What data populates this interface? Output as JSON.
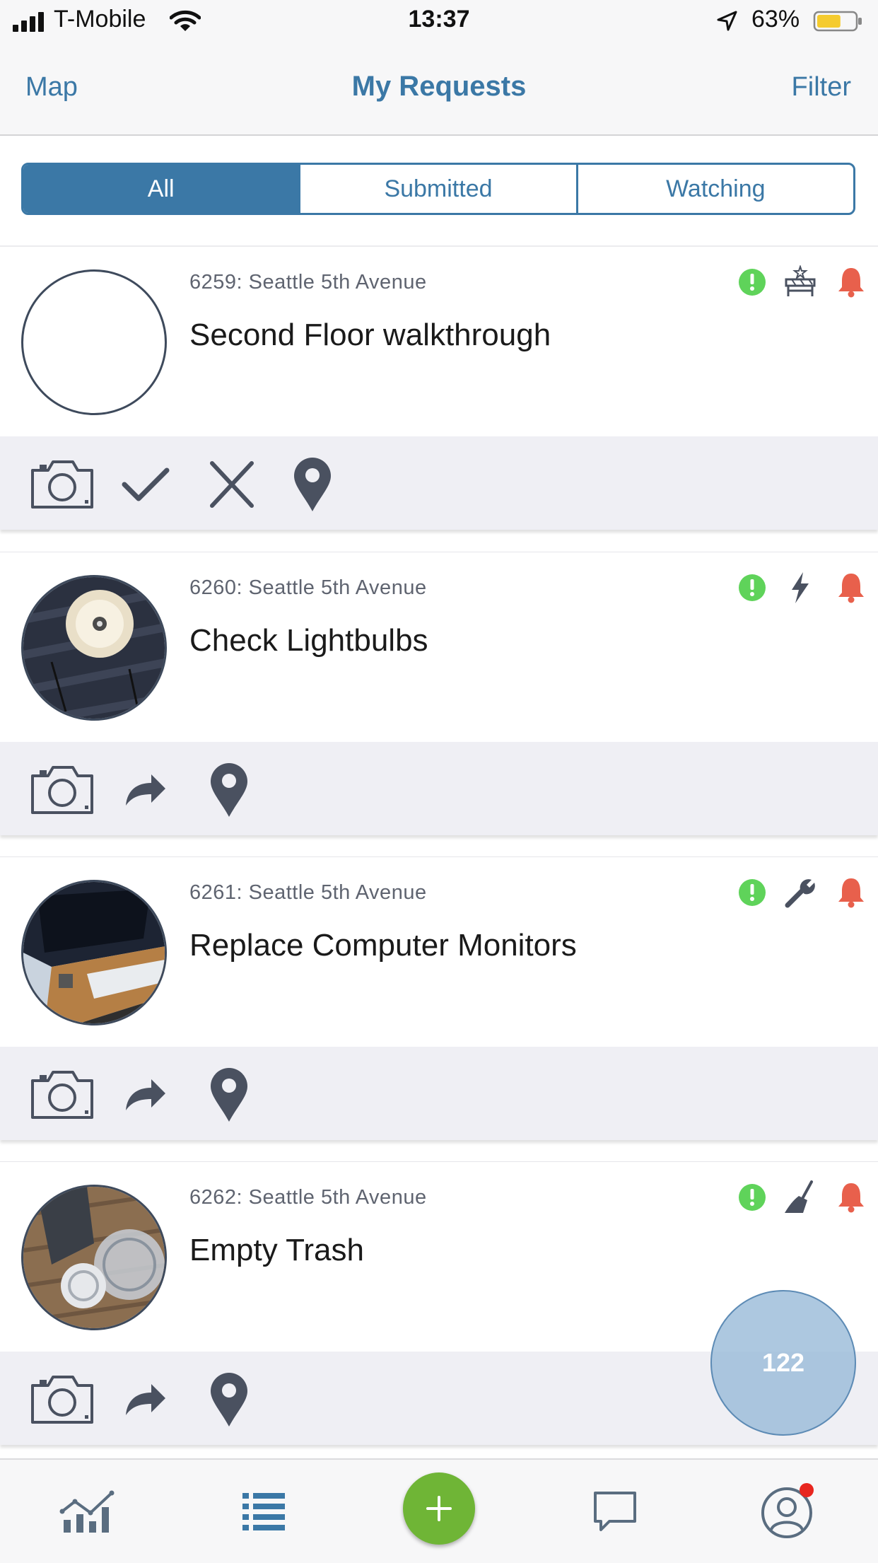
{
  "status_bar": {
    "carrier": "T-Mobile",
    "time": "13:37",
    "battery_percent": "63%",
    "battery_level": 0.63
  },
  "nav": {
    "left": "Map",
    "title": "My Requests",
    "right": "Filter"
  },
  "segments": [
    {
      "label": "All",
      "active": true
    },
    {
      "label": "Submitted",
      "active": false
    },
    {
      "label": "Watching",
      "active": false
    }
  ],
  "requests": [
    {
      "subtitle": "6259: Seattle 5th Avenue",
      "title": "Second Floor walkthrough",
      "photo": "none",
      "category_icon": "furniture-icon",
      "actions": [
        "camera-icon",
        "checkmark-icon",
        "close-icon",
        "location-pin-icon"
      ]
    },
    {
      "subtitle": "6260: Seattle 5th Avenue",
      "title": "Check Lightbulbs",
      "photo": "lightbulb-photo",
      "category_icon": "lightning-icon",
      "actions": [
        "camera-icon",
        "forward-icon",
        "location-pin-icon"
      ]
    },
    {
      "subtitle": "6261: Seattle 5th Avenue",
      "title": "Replace Computer Monitors",
      "photo": "monitor-photo",
      "category_icon": "wrench-icon",
      "actions": [
        "camera-icon",
        "forward-icon",
        "location-pin-icon"
      ]
    },
    {
      "subtitle": "6262: Seattle 5th Avenue",
      "title": "Empty Trash",
      "photo": "trash-photo",
      "category_icon": "broom-icon",
      "actions": [
        "camera-icon",
        "forward-icon",
        "location-pin-icon"
      ]
    }
  ],
  "floating_badge": {
    "count": "122"
  },
  "tab_bar": {
    "tabs": [
      "chart-icon",
      "list-icon",
      "add-icon",
      "chat-icon",
      "profile-icon"
    ],
    "profile_has_notification": true
  },
  "colors": {
    "accent": "#3b78a6",
    "status_green": "#5fd35a",
    "alert_red": "#e8604c",
    "add_green": "#6fb536",
    "icon_gray": "#4a5160"
  }
}
